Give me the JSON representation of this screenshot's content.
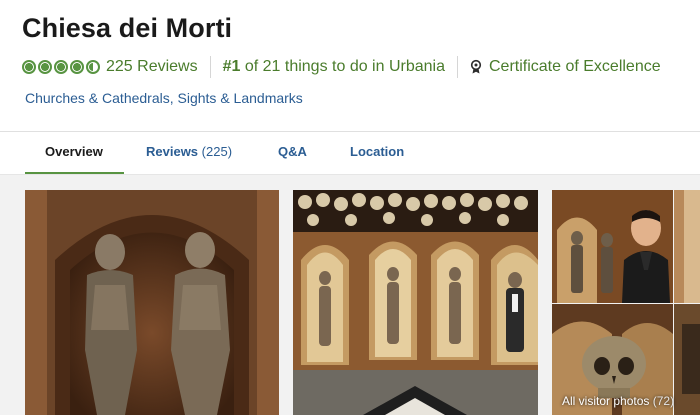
{
  "header": {
    "title": "Chiesa dei Morti",
    "rating": 4.5,
    "reviews_label": "225 Reviews",
    "rank_number": "#1",
    "rank_text": " of 21 things to do in Urbania",
    "certificate": "Certificate of Excellence",
    "categories": "Churches & Cathedrals, Sights & Landmarks"
  },
  "tabs": [
    {
      "label": "Overview",
      "count": ""
    },
    {
      "label": "Reviews",
      "count": "(225)"
    },
    {
      "label": "Q&A",
      "count": ""
    },
    {
      "label": "Location",
      "count": ""
    }
  ],
  "gallery": {
    "all_photos_label": "All visitor photos",
    "all_photos_count": "(72)"
  },
  "colors": {
    "accent_green": "#589442",
    "link_blue": "#2b5d93"
  }
}
